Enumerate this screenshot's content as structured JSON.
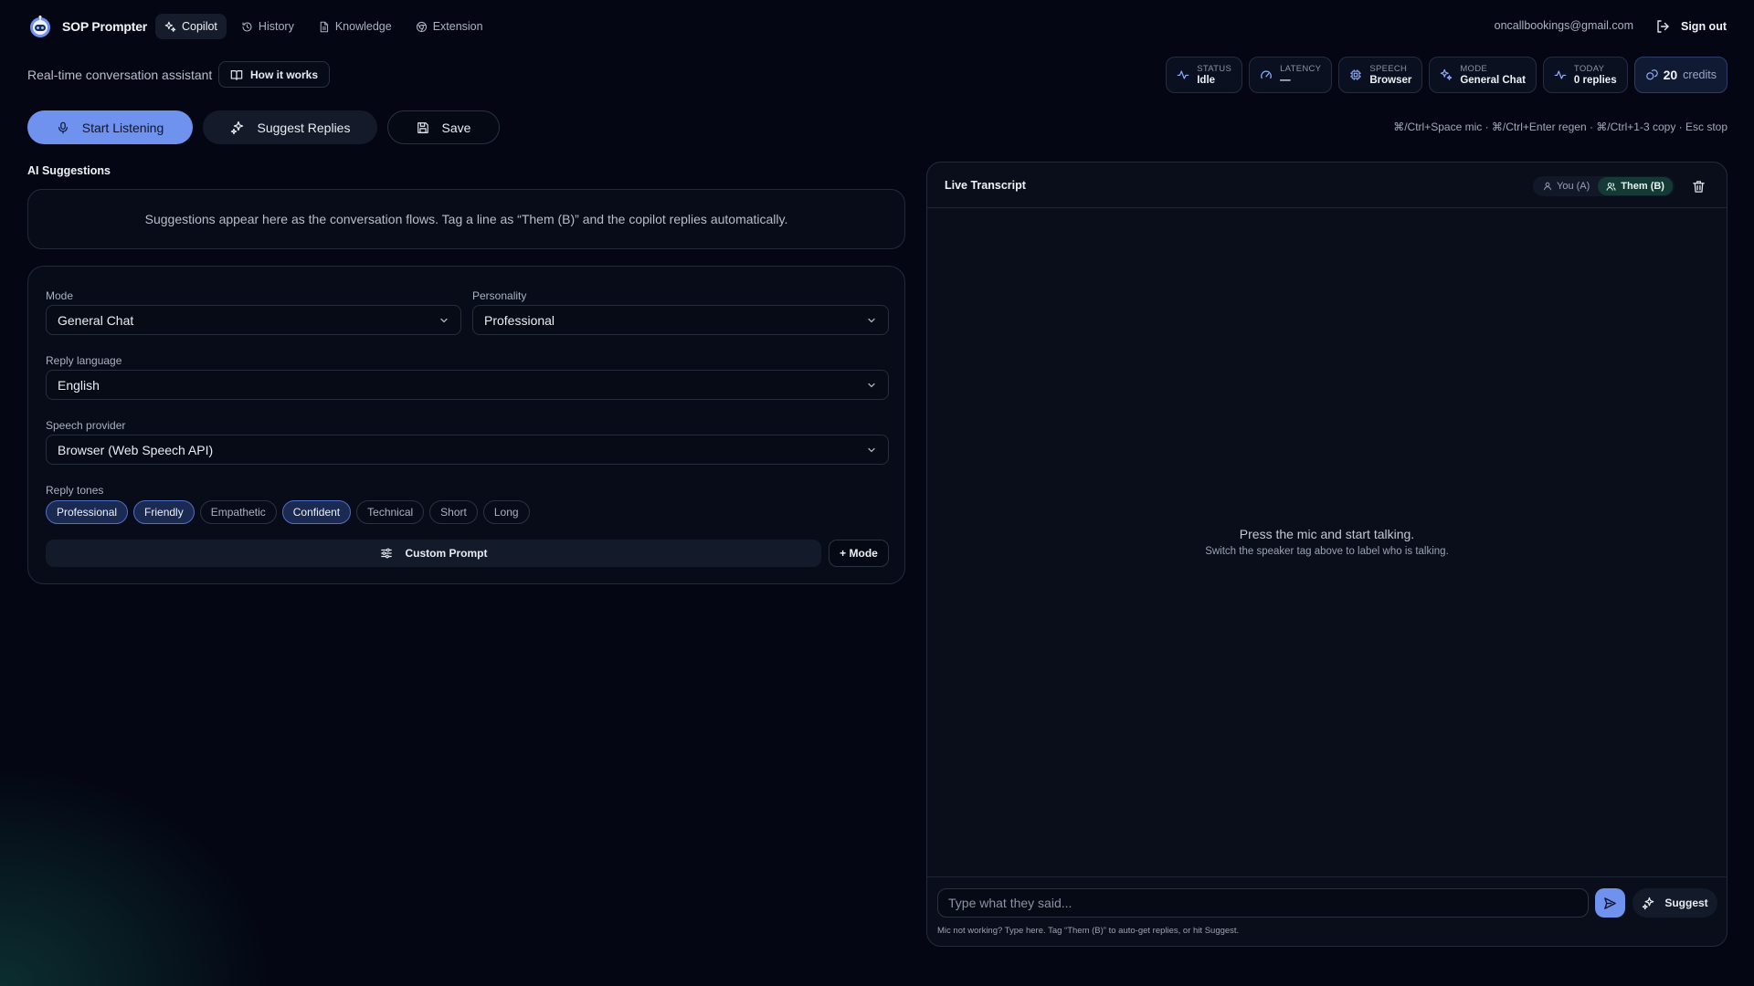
{
  "brand": {
    "name": "SOP Prompter"
  },
  "nav": [
    {
      "label": "Copilot",
      "icon": "sparkles-icon",
      "active": true
    },
    {
      "label": "History",
      "icon": "history-icon",
      "active": false
    },
    {
      "label": "Knowledge",
      "icon": "document-icon",
      "active": false
    },
    {
      "label": "Extension",
      "icon": "chrome-icon",
      "active": false
    }
  ],
  "user": {
    "email": "oncallbookings@gmail.com",
    "signout_label": "Sign out"
  },
  "header": {
    "subtitle": "Real-time conversation assistant",
    "how_it_works": "How it works"
  },
  "stats": [
    {
      "label": "STATUS",
      "value": "Idle",
      "icon": "activity-icon"
    },
    {
      "label": "LATENCY",
      "value": "—",
      "icon": "gauge-icon"
    },
    {
      "label": "SPEECH",
      "value": "Browser",
      "icon": "cpu-icon"
    },
    {
      "label": "MODE",
      "value": "General Chat",
      "icon": "sparkles-icon"
    },
    {
      "label": "TODAY",
      "value": "0 replies",
      "icon": "activity-icon"
    }
  ],
  "credits": {
    "value": "20",
    "unit": "credits"
  },
  "actions": {
    "listen": "Start Listening",
    "suggest": "Suggest Replies",
    "save": "Save"
  },
  "shortcuts": "⌘/Ctrl+Space mic · ⌘/Ctrl+Enter regen · ⌘/Ctrl+1-3 copy · Esc stop",
  "suggestions": {
    "title": "AI Suggestions",
    "empty": "Suggestions appear here as the conversation flows. Tag a line as “Them (B)” and the copilot replies automatically."
  },
  "settings": {
    "mode": {
      "label": "Mode",
      "value": "General Chat"
    },
    "personality": {
      "label": "Personality",
      "value": "Professional"
    },
    "language": {
      "label": "Reply language",
      "value": "English"
    },
    "speech": {
      "label": "Speech provider",
      "value": "Browser (Web Speech API)"
    },
    "tones_label": "Reply tones",
    "tones": [
      {
        "label": "Professional",
        "selected": true
      },
      {
        "label": "Friendly",
        "selected": true
      },
      {
        "label": "Empathetic",
        "selected": false
      },
      {
        "label": "Confident",
        "selected": true
      },
      {
        "label": "Technical",
        "selected": false
      },
      {
        "label": "Short",
        "selected": false
      },
      {
        "label": "Long",
        "selected": false
      }
    ],
    "custom_prompt": "Custom Prompt",
    "add_mode": "+ Mode"
  },
  "transcript": {
    "title": "Live Transcript",
    "speaker_you": "You (A)",
    "speaker_them": "Them (B)",
    "active_speaker": "them",
    "empty_title": "Press the mic and start talking.",
    "empty_sub": "Switch the speaker tag above to label who is talking.",
    "input_placeholder": "Type what they said...",
    "suggest_label": "Suggest",
    "hint": "Mic not working? Type here. Tag “Them (B)” to auto-get replies, or hit Suggest."
  },
  "colors": {
    "accent": "#6f92ee",
    "background": "#040713",
    "active_speaker": "#133a35",
    "tone_selected": "#1a2a52"
  }
}
